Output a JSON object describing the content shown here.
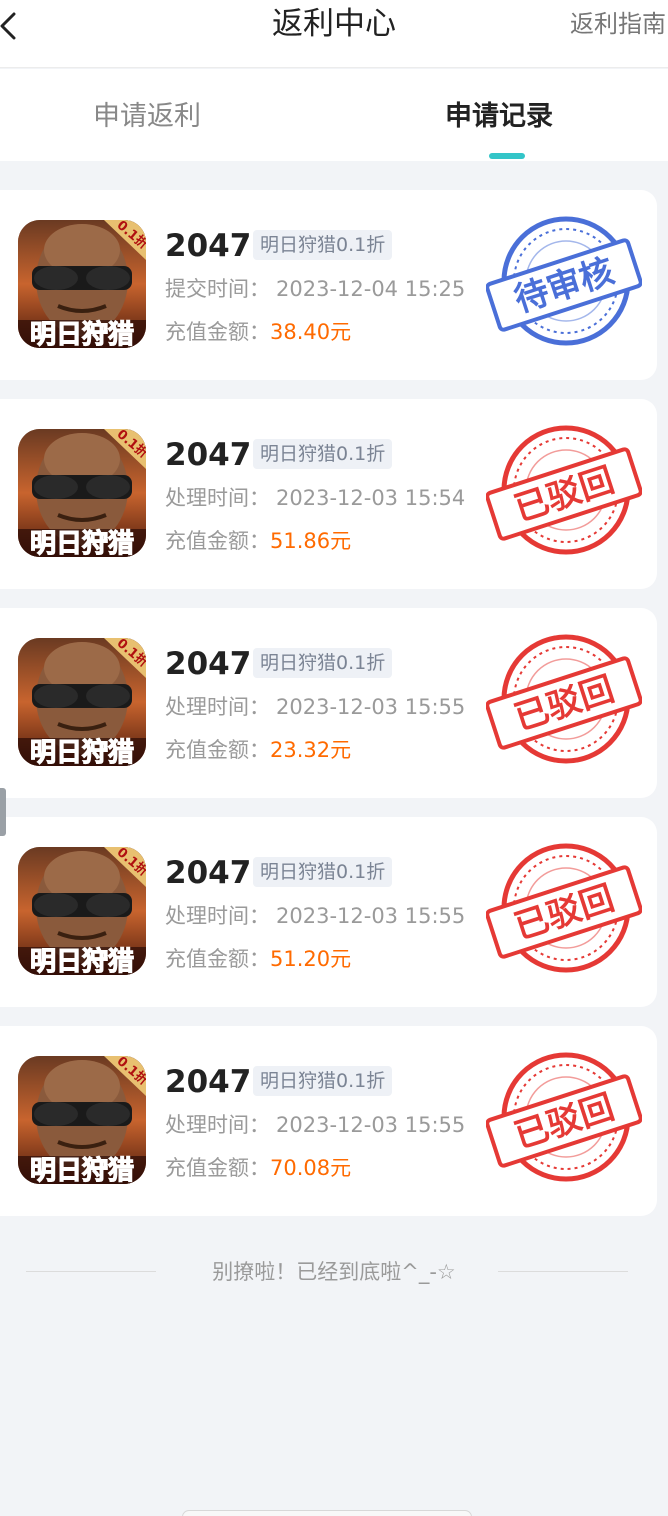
{
  "header": {
    "title": "返利中心",
    "guide_link": "返利指南"
  },
  "tabs": [
    {
      "label": "申请返利",
      "active": false
    },
    {
      "label": "申请记录",
      "active": true
    }
  ],
  "records": [
    {
      "game_name": "2047",
      "tag": "明日狩猎0.1折",
      "time_label": "提交时间：",
      "time_value": "2023-12-04 15:25",
      "amount_label": "充值金额：",
      "amount_value": "38.40元",
      "status": "待审核",
      "status_color": "#4a6fd8"
    },
    {
      "game_name": "2047",
      "tag": "明日狩猎0.1折",
      "time_label": "处理时间：",
      "time_value": "2023-12-03 15:54",
      "amount_label": "充值金额：",
      "amount_value": "51.86元",
      "status": "已驳回",
      "status_color": "#e53935"
    },
    {
      "game_name": "2047",
      "tag": "明日狩猎0.1折",
      "time_label": "处理时间：",
      "time_value": "2023-12-03 15:55",
      "amount_label": "充值金额：",
      "amount_value": "23.32元",
      "status": "已驳回",
      "status_color": "#e53935"
    },
    {
      "game_name": "2047",
      "tag": "明日狩猎0.1折",
      "time_label": "处理时间：",
      "time_value": "2023-12-03 15:55",
      "amount_label": "充值金额：",
      "amount_value": "51.20元",
      "status": "已驳回",
      "status_color": "#e53935"
    },
    {
      "game_name": "2047",
      "tag": "明日狩猎0.1折",
      "time_label": "处理时间：",
      "time_value": "2023-12-03 15:55",
      "amount_label": "充值金额：",
      "amount_value": "70.08元",
      "status": "已驳回",
      "status_color": "#e53935"
    }
  ],
  "game_icon": {
    "badge": "0.1折",
    "title_text": "明日狩猎"
  },
  "footer": {
    "end_text": "别撩啦！已经到底啦^_-☆"
  },
  "colors": {
    "accent": "#33c5c8",
    "amount": "#ff6a00",
    "pending_stamp": "#4a6fd8",
    "rejected_stamp": "#e53935"
  }
}
